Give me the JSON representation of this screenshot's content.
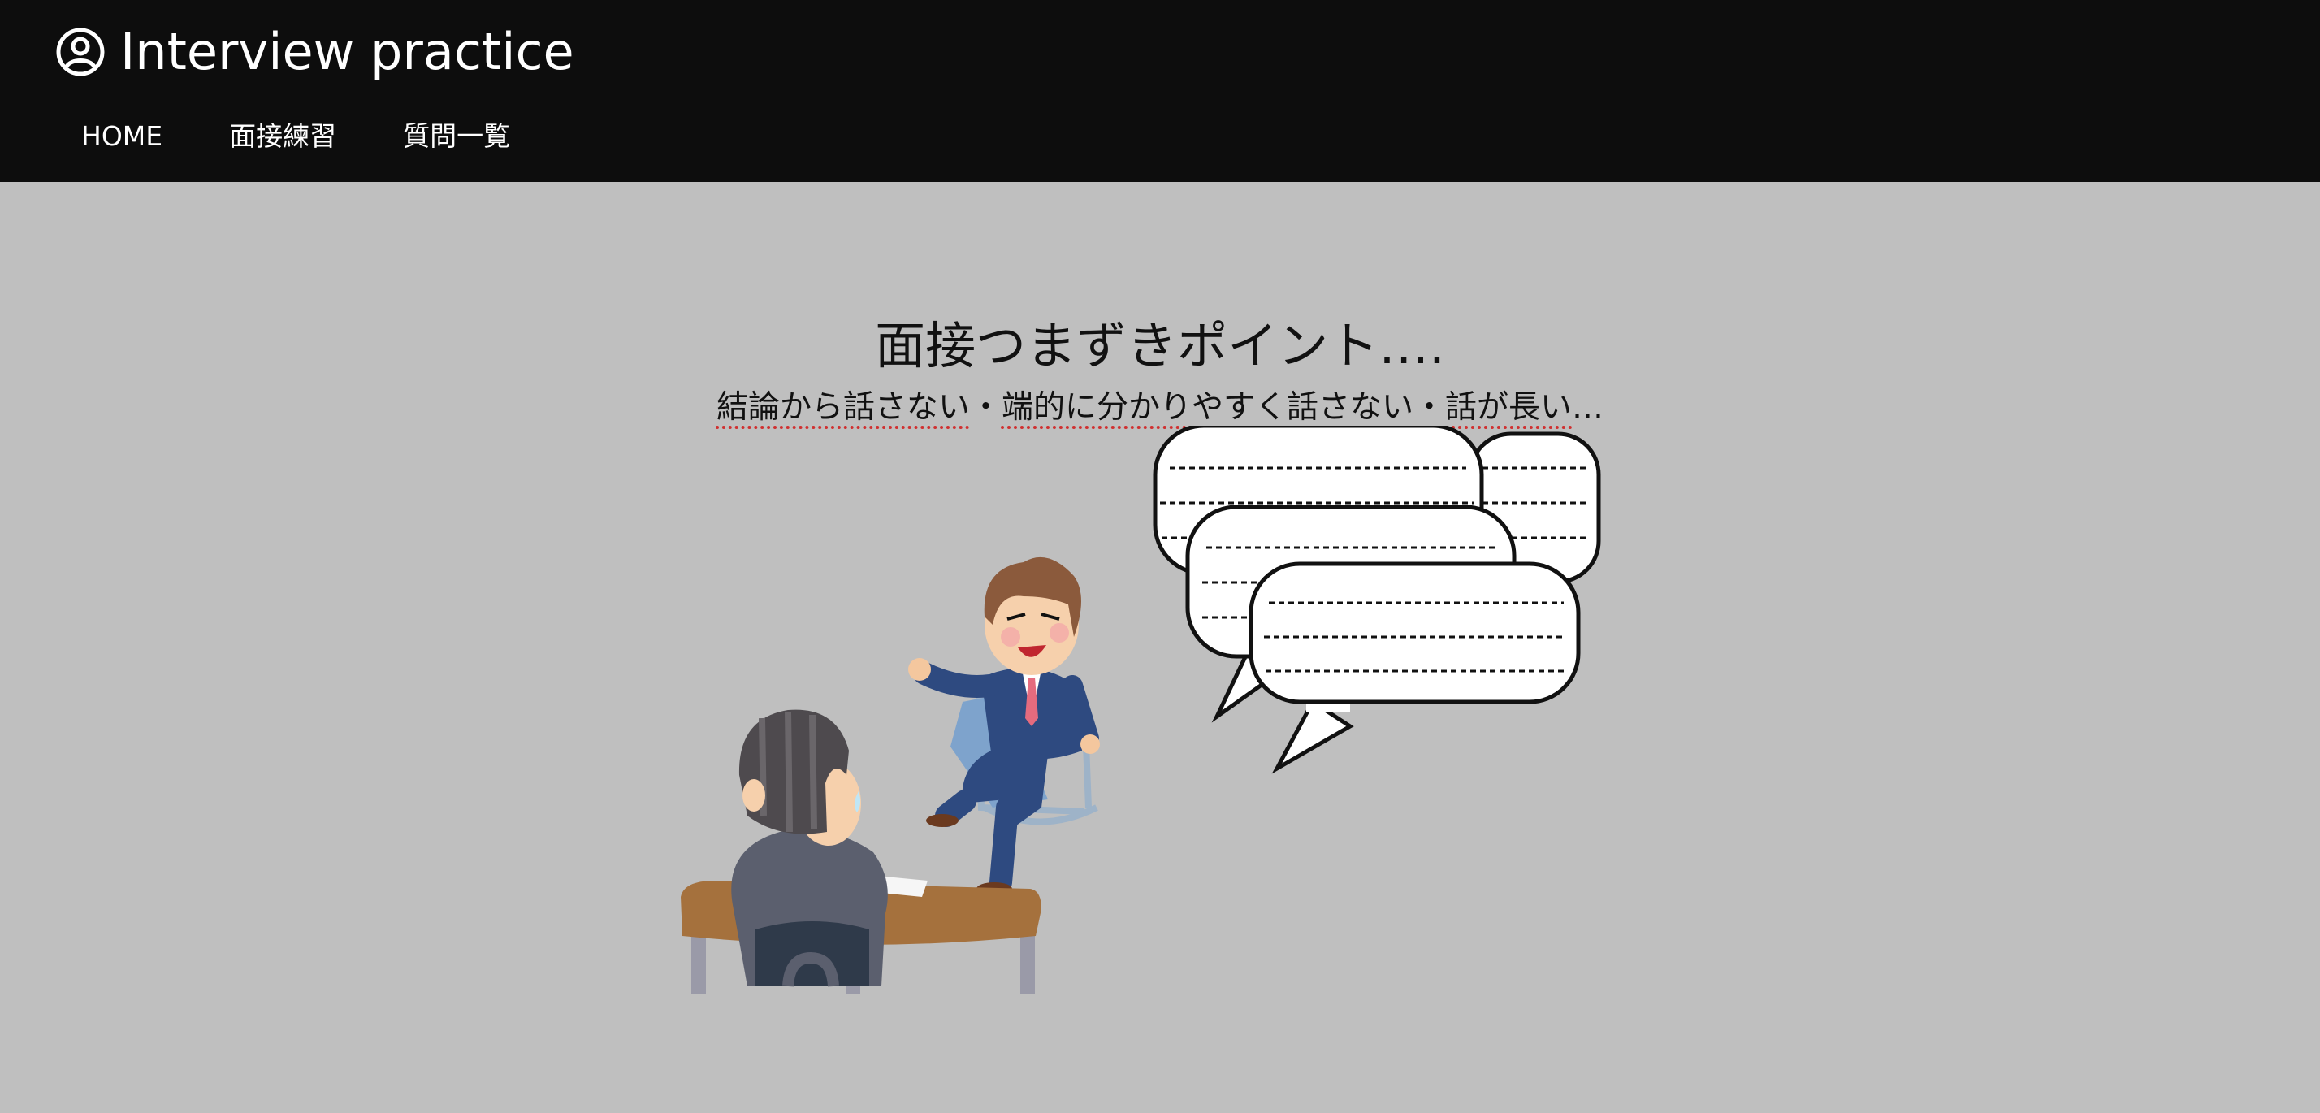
{
  "header": {
    "brand_icon": "user-circle-icon",
    "title": "Interview practice",
    "nav": [
      {
        "label": "HOME"
      },
      {
        "label": "面接練習"
      },
      {
        "label": "質問一覧"
      }
    ]
  },
  "hero": {
    "headline": "面接つまずきポイント….",
    "problems": [
      "結論から話さない",
      "端的に分かりやすく話さない",
      "話が長い"
    ],
    "separator": "・",
    "trailing": "…"
  },
  "colors": {
    "header_bg": "#0d0d0d",
    "page_bg": "#bfbfbf",
    "spellcheck_underline": "#d03030"
  }
}
